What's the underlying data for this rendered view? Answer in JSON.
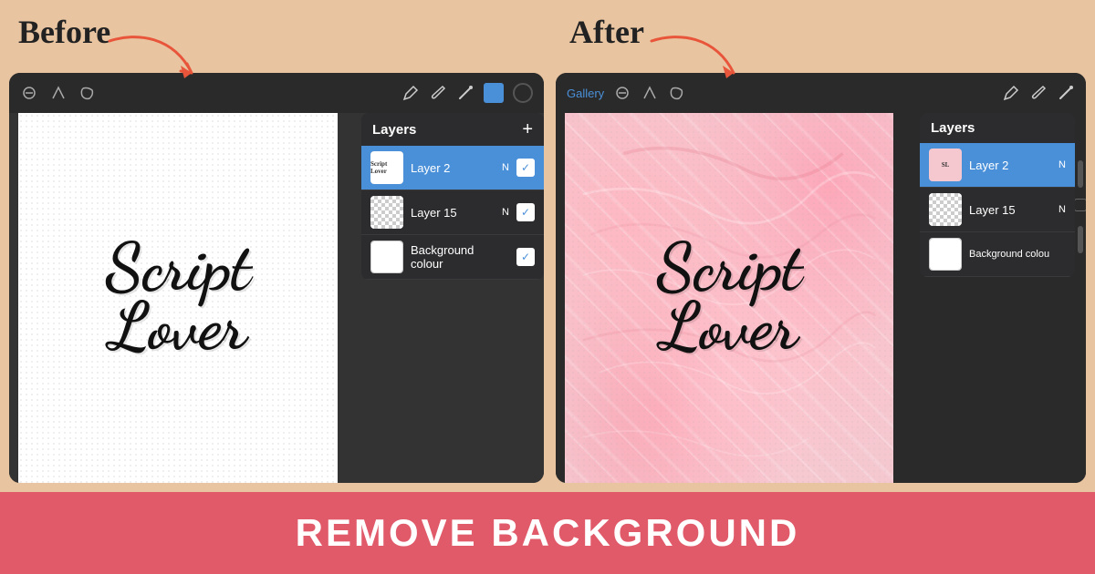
{
  "before_label": "Before",
  "after_label": "After",
  "bottom_bar": {
    "text": "REMOVE BACKGROUND"
  },
  "layers_panel_before": {
    "title": "Layers",
    "add_button": "+",
    "layers": [
      {
        "name": "Layer 2",
        "blend": "N",
        "active": true
      },
      {
        "name": "Layer 15",
        "blend": "N",
        "active": false
      },
      {
        "name": "Background colour",
        "blend": "",
        "active": false
      }
    ]
  },
  "layers_panel_after": {
    "title": "Layers",
    "layers": [
      {
        "name": "Layer 2",
        "blend": "N",
        "active": true
      },
      {
        "name": "Layer 15",
        "blend": "N",
        "active": false
      },
      {
        "name": "Background colour",
        "blend": "",
        "active": false
      }
    ]
  },
  "script_text_line1": "Script",
  "script_text_line2": "Lover",
  "toolbar": {
    "gallery": "Gallery"
  },
  "colors": {
    "background": "#e8c4a0",
    "bottom_bar": "#e05a6a",
    "active_layer": "#4a90d9"
  }
}
